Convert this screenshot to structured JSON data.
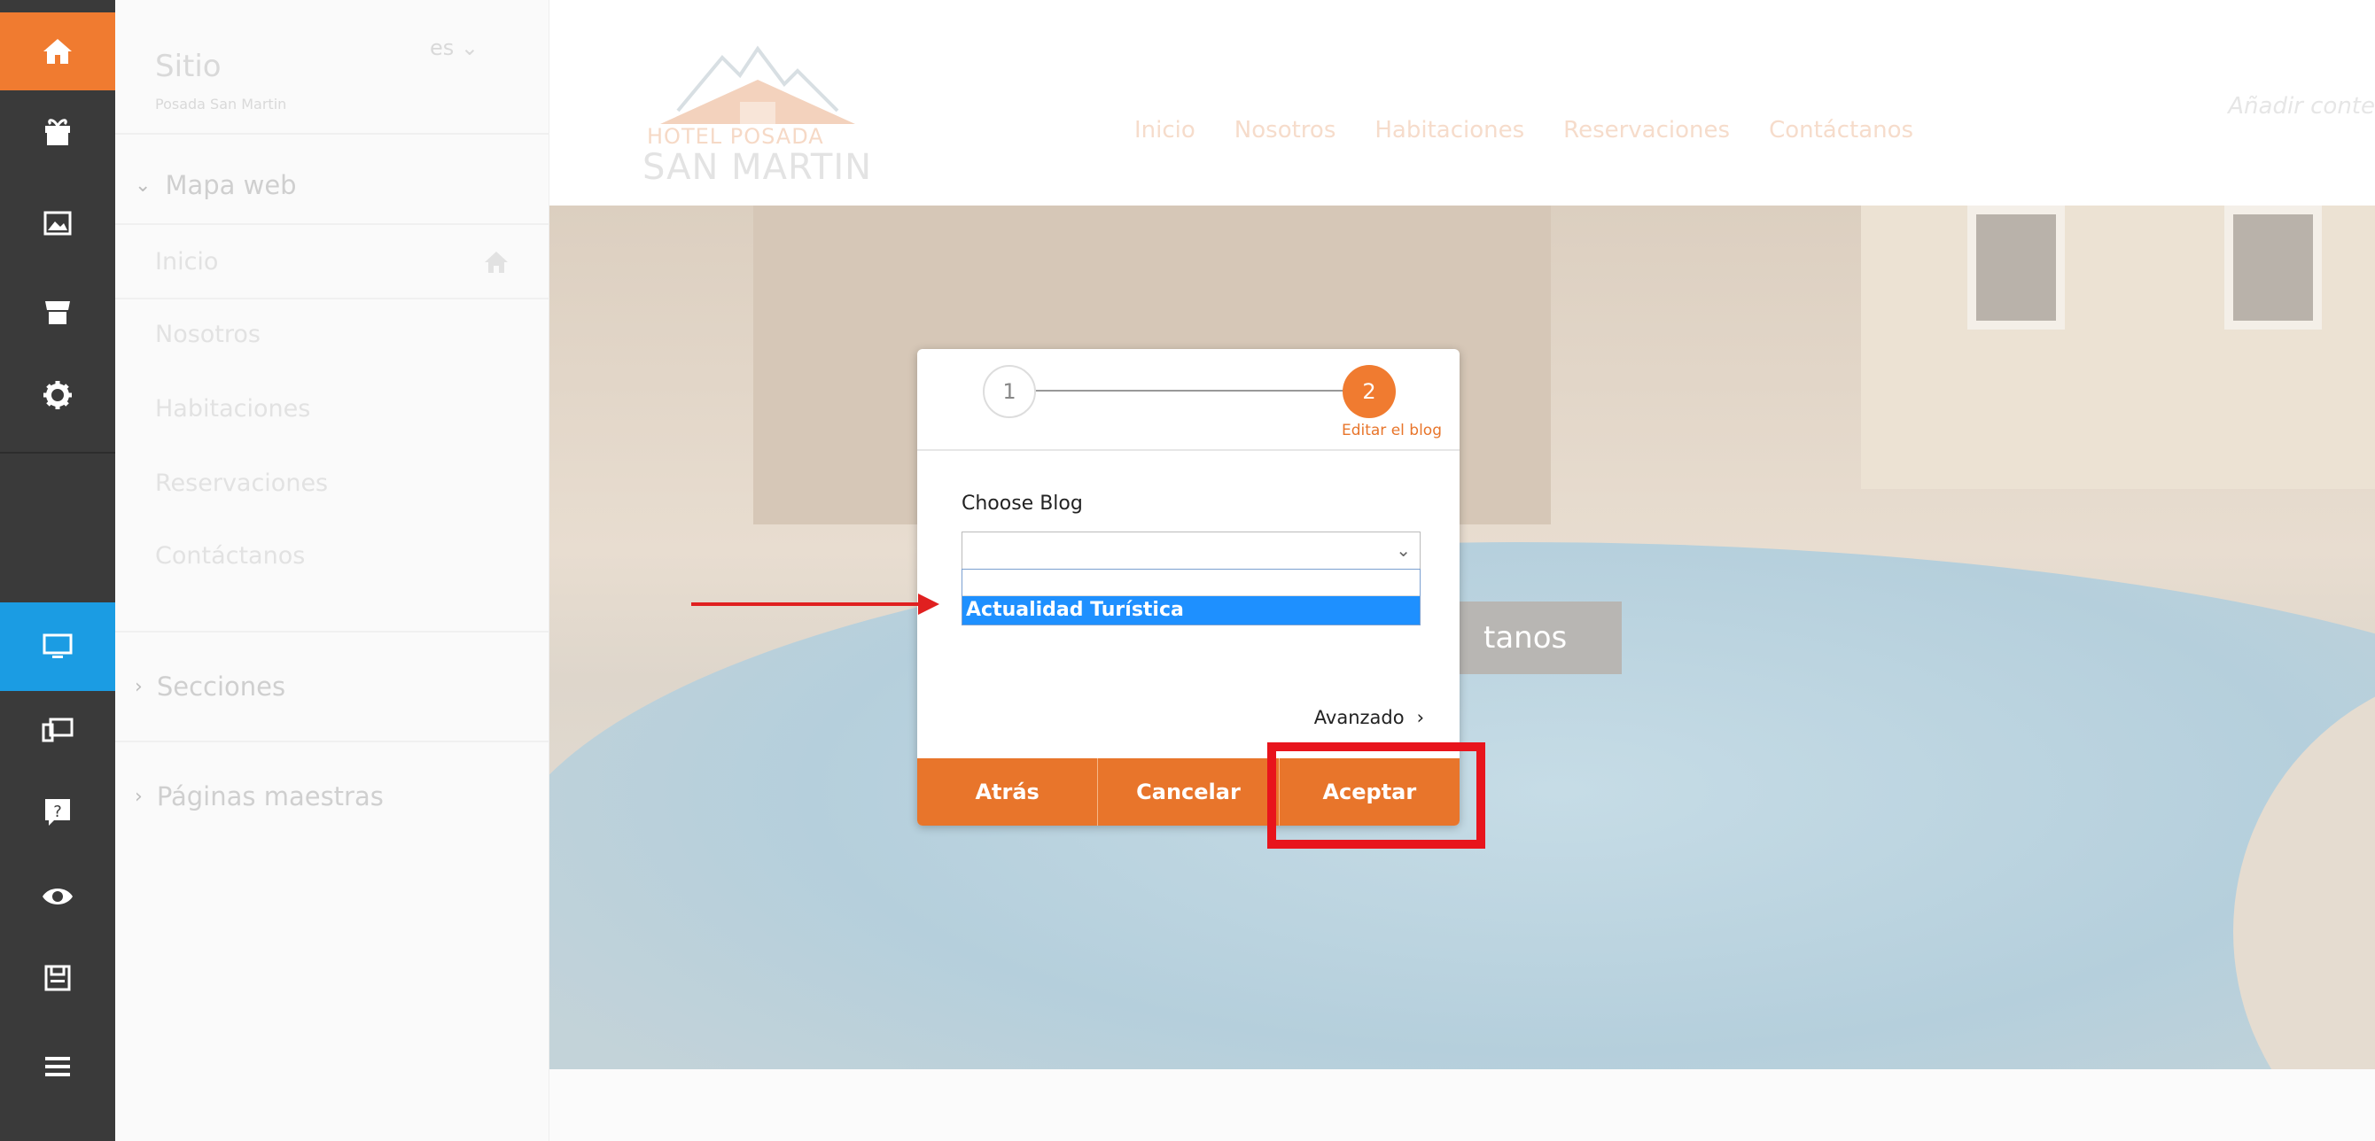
{
  "rail": {
    "items": [
      {
        "name": "home-icon",
        "style": "orange"
      },
      {
        "name": "gift-icon",
        "style": "dark"
      },
      {
        "name": "gallery-icon",
        "style": "dark"
      },
      {
        "name": "shop-icon",
        "style": "dark"
      },
      {
        "name": "gear-icon",
        "style": "dark"
      },
      {
        "name": "desktop-icon",
        "style": "blue"
      },
      {
        "name": "multi-device-icon",
        "style": "dark"
      },
      {
        "name": "help-icon",
        "style": "dark"
      },
      {
        "name": "eye-icon",
        "style": "dark"
      },
      {
        "name": "save-icon",
        "style": "dark"
      },
      {
        "name": "menu-icon",
        "style": "dark"
      }
    ]
  },
  "sidebar": {
    "title": "Sitio",
    "subtitle": "Posada San Martin",
    "language": "es",
    "sitemap_label": "Mapa web",
    "pages": [
      "Inicio",
      "Nosotros",
      "Habitaciones",
      "Reservaciones",
      "Contáctanos"
    ],
    "sections_label": "Secciones",
    "master_pages_label": "Páginas maestras"
  },
  "header": {
    "logo_line1": "HOTEL POSADA",
    "logo_line2": "SAN MARTIN",
    "nav": [
      "Inicio",
      "Nosotros",
      "Habitaciones",
      "Reservaciones",
      "Contáctanos"
    ],
    "add_content": "Añadir conte"
  },
  "hero": {
    "button_partial": "tanos"
  },
  "dialog": {
    "step1": "1",
    "step2": "2",
    "step2_label": "Editar el blog",
    "choose_label": "Choose Blog",
    "select_value": "",
    "option_selected": "Actualidad Turística",
    "advanced_label": "Avanzado",
    "advanced_chevron": "›",
    "back_label": "Atrás",
    "cancel_label": "Cancelar",
    "accept_label": "Aceptar"
  },
  "colors": {
    "accent_orange": "#e8752b",
    "rail_dark": "#3a3a3a",
    "rail_active_blue": "#1b9ce3",
    "selection_blue": "#1e90ff",
    "annotation_red": "#e8141c"
  }
}
